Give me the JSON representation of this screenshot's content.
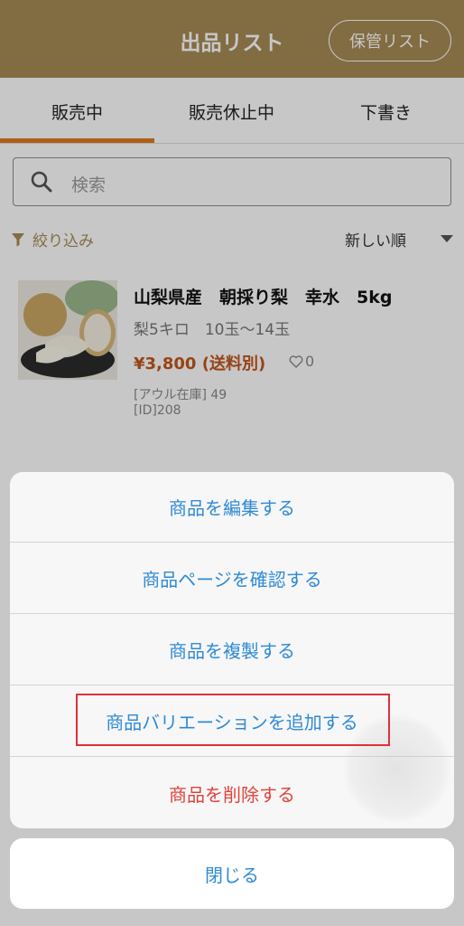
{
  "header": {
    "title": "出品リスト",
    "storage_button": "保管リスト"
  },
  "tabs": [
    {
      "label": "販売中",
      "active": true
    },
    {
      "label": "販売休止中",
      "active": false
    },
    {
      "label": "下書き",
      "active": false
    }
  ],
  "search": {
    "placeholder": "検索"
  },
  "filter": {
    "label": "絞り込み"
  },
  "sort": {
    "label": "新しい順"
  },
  "product": {
    "title": "山梨県産　朝採り梨　幸水　5kg",
    "subtitle": "梨5キロ　10玉〜14玉",
    "price": "¥3,800 (送料別)",
    "likes": "0",
    "stock": "[アウル在庫] 49",
    "id": "[ID]208"
  },
  "action_sheet": {
    "items": [
      "商品を編集する",
      "商品ページを確認する",
      "商品を複製する",
      "商品バリエーションを追加する",
      "商品を削除する"
    ],
    "close": "閉じる"
  },
  "colors": {
    "header_bg": "#a78b55",
    "tab_accent": "#e07a20",
    "action_blue": "#2f8ad6",
    "danger_red": "#e0423c",
    "price": "#c2561b"
  }
}
